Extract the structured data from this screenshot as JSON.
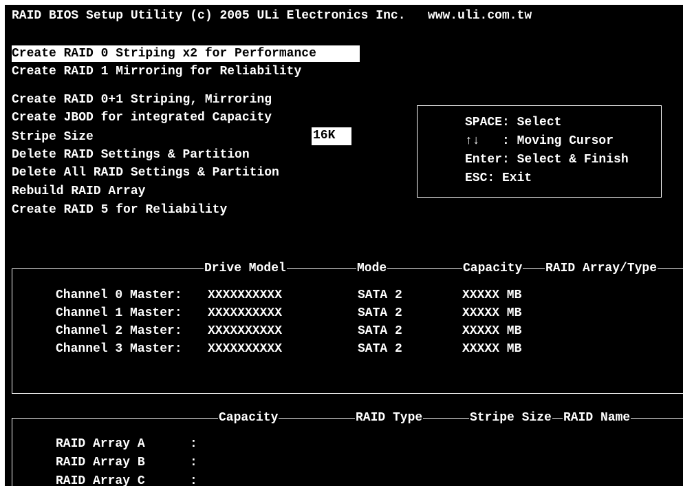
{
  "header": {
    "title": "RAID BIOS Setup Utility (c) 2005 ULi Electronics Inc.   www.uli.com.tw"
  },
  "menu": {
    "items": [
      {
        "label": "Create RAID 0 Striping x2 for Performance",
        "selected": true
      },
      {
        "label": "Create RAID 1 Mirroring for Reliability"
      },
      {
        "label": "Create RAID 0+1 Striping, Mirroring"
      },
      {
        "label": "Create JBOD for integrated Capacity"
      },
      {
        "label": "Stripe Size"
      },
      {
        "label": "Delete RAID Settings & Partition"
      },
      {
        "label": "Delete All RAID Settings & Partition"
      },
      {
        "label": "Rebuild RAID Array"
      },
      {
        "label": "Create RAID 5 for Reliability"
      }
    ],
    "stripe_size_value": "16K"
  },
  "help": {
    "line1": "SPACE: Select",
    "line2": "↑↓   : Moving Cursor",
    "line3": "Enter: Select & Finish",
    "line4": "ESC: Exit"
  },
  "drives": {
    "headers": {
      "drive_model": "Drive Model",
      "mode": "Mode",
      "capacity": "Capacity",
      "raid": "RAID Array/Type"
    },
    "rows": [
      {
        "channel": "Channel 0 Master:",
        "model": "XXXXXXXXXX",
        "mode": "SATA 2",
        "capacity": "XXXXX MB"
      },
      {
        "channel": "Channel 1 Master:",
        "model": "XXXXXXXXXX",
        "mode": "SATA 2",
        "capacity": "XXXXX MB"
      },
      {
        "channel": "Channel 2 Master:",
        "model": "XXXXXXXXXX",
        "mode": "SATA 2",
        "capacity": "XXXXX MB"
      },
      {
        "channel": "Channel 3 Master:",
        "model": "XXXXXXXXXX",
        "mode": "SATA 2",
        "capacity": "XXXXX MB"
      }
    ]
  },
  "arrays": {
    "headers": {
      "capacity": "Capacity",
      "raid_type": "RAID Type",
      "stripe_size": "Stripe Size",
      "raid_name": "RAID Name"
    },
    "rows": [
      {
        "name": "RAID Array A",
        "sep": ":"
      },
      {
        "name": "RAID Array B",
        "sep": ":"
      },
      {
        "name": "RAID Array C",
        "sep": ":"
      }
    ]
  }
}
